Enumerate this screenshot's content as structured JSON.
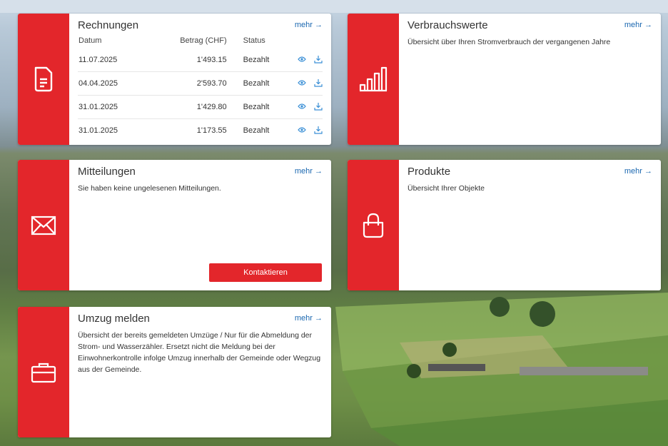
{
  "rechnungen": {
    "title": "Rechnungen",
    "more": "mehr →",
    "columns": [
      "Datum",
      "Betrag (CHF)",
      "Status"
    ],
    "rows": [
      {
        "date": "11.07.2025",
        "amount": "1'493.15",
        "status": "Bezahlt"
      },
      {
        "date": "04.04.2025",
        "amount": "2'593.70",
        "status": "Bezahlt"
      },
      {
        "date": "31.01.2025",
        "amount": "1'429.80",
        "status": "Bezahlt"
      },
      {
        "date": "31.01.2025",
        "amount": "1'173.55",
        "status": "Bezahlt"
      }
    ],
    "icon": "document-icon"
  },
  "verbrauchswerte": {
    "title": "Verbrauchswerte",
    "more": "mehr →",
    "description": "Übersicht über Ihren Stromverbrauch der vergangenen Jahre",
    "icon": "bar-chart-icon"
  },
  "mitteilungen": {
    "title": "Mitteilungen",
    "more": "mehr →",
    "description": "Sie haben keine ungelesenen Mitteilungen.",
    "button": "Kontaktieren",
    "icon": "envelope-icon"
  },
  "produkte": {
    "title": "Produkte",
    "more": "mehr →",
    "description": "Übersicht Ihrer Objekte",
    "icon": "shopping-bag-icon"
  },
  "umzug": {
    "title": "Umzug melden",
    "more": "mehr →",
    "description": "Übersicht der bereits gemeldeten Umzüge / Nur für die Abmeldung der Strom- und Wasserzähler. Ersetzt nicht die Meldung bei der Einwohnerkontrolle infolge Umzug innerhalb der Gemeinde oder Wegzug aus der Gemeinde.",
    "icon": "briefcase-icon"
  },
  "colors": {
    "accent": "#e3262b",
    "link": "#1a67b0"
  }
}
